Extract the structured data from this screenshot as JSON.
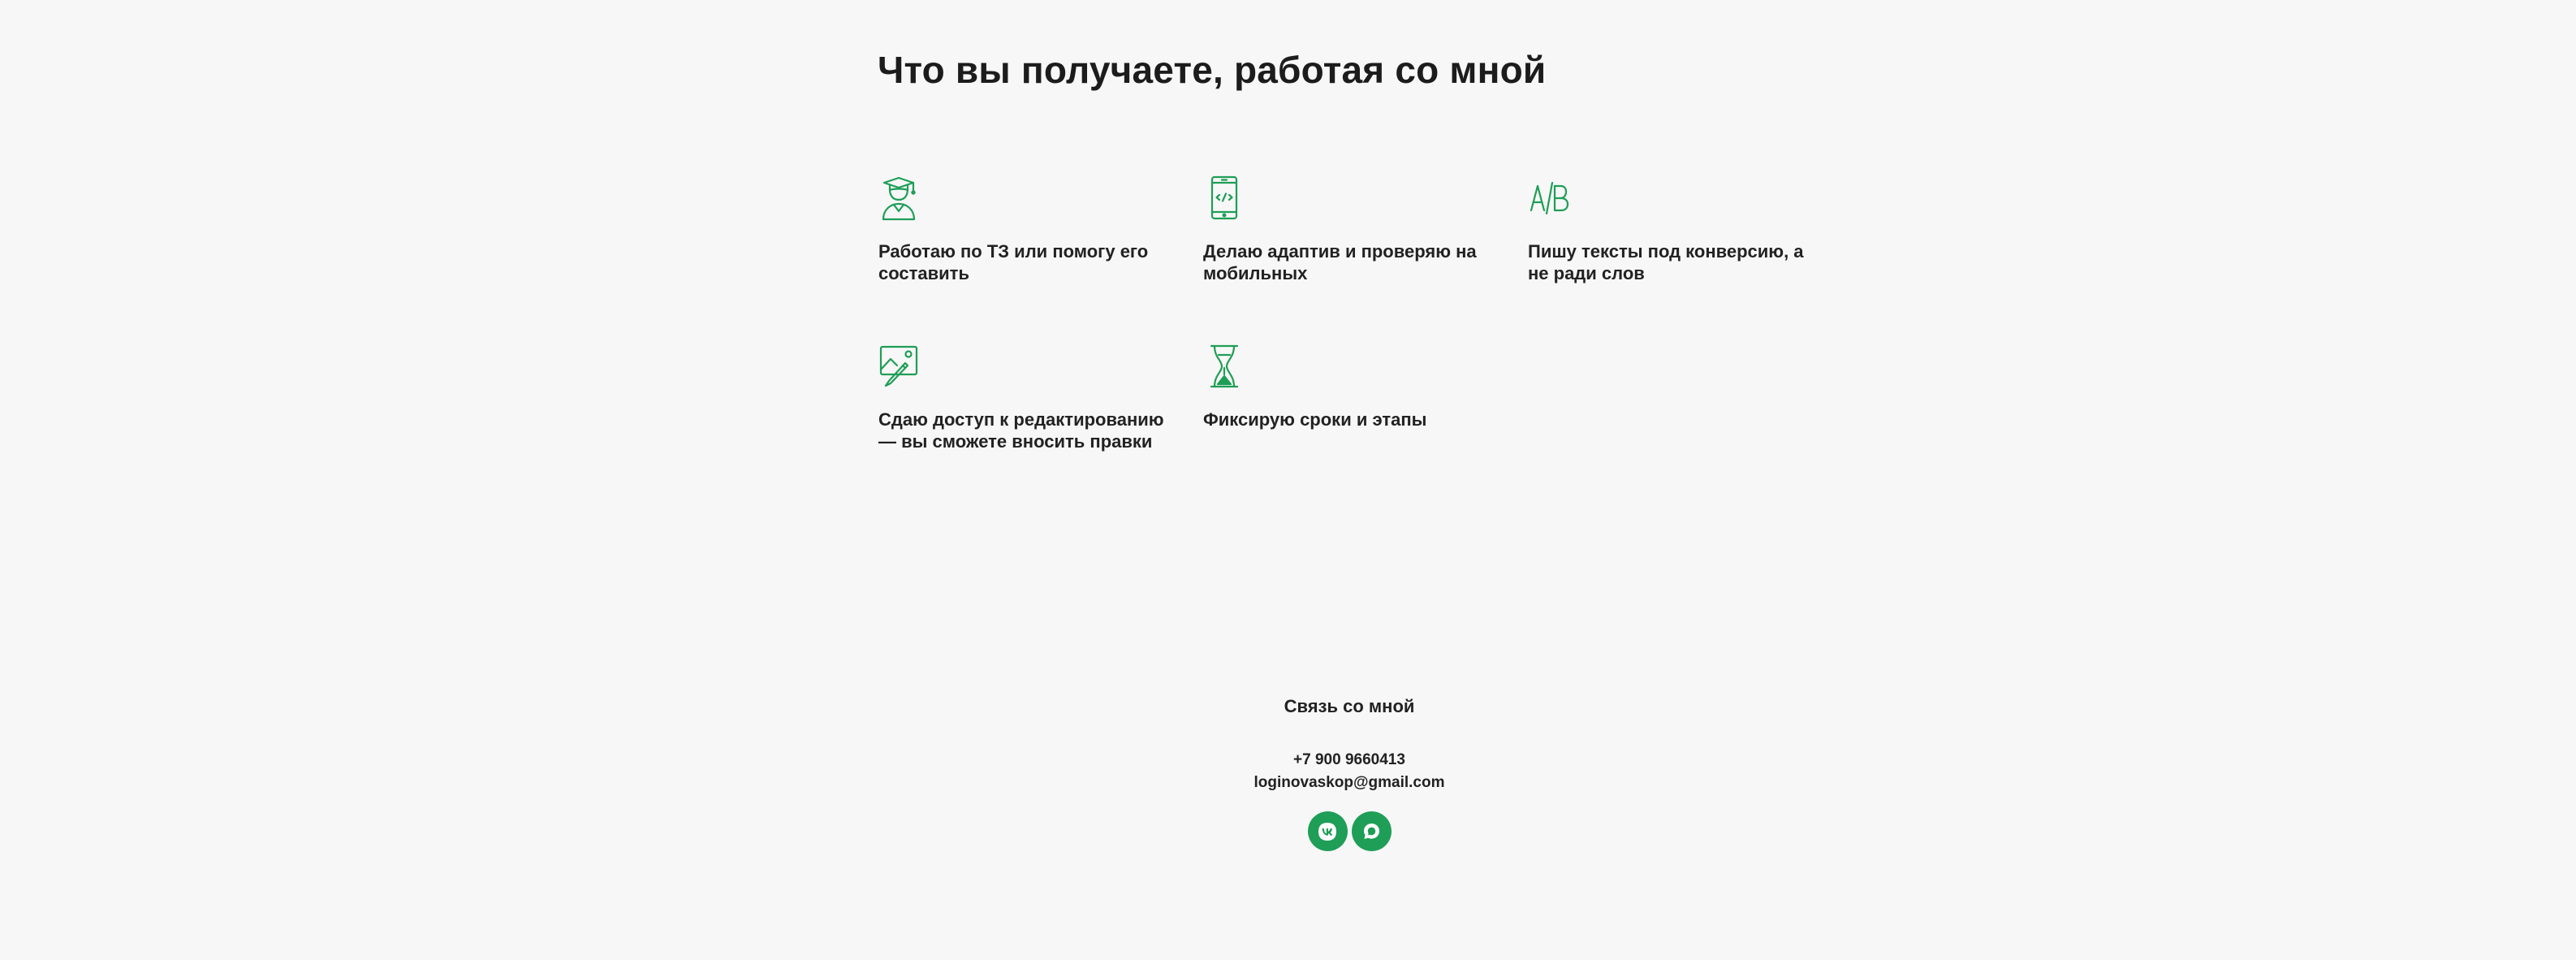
{
  "section": {
    "title": "Что вы получаете, работая со мной"
  },
  "features": [
    {
      "icon": "graduate-icon",
      "text": "Работаю по ТЗ или помогу его составить"
    },
    {
      "icon": "mobile-code-icon",
      "text": "Делаю адаптив и проверяю на мобильных"
    },
    {
      "icon": "ab-test-icon",
      "text": "Пишу тексты под конверсию, а не ради слов"
    },
    {
      "icon": "image-edit-icon",
      "text": "Сдаю доступ к редактированию — вы сможете вносить правки"
    },
    {
      "icon": "hourglass-icon",
      "text": "Фиксирую сроки и этапы"
    }
  ],
  "contacts": {
    "title": "Связь со мной",
    "phone": "+7 900 9660413",
    "email": "loginovaskop@gmail.com",
    "socials": [
      {
        "icon": "vk-icon"
      },
      {
        "icon": "chat-icon"
      }
    ]
  },
  "colors": {
    "accent": "#1e9e56",
    "background": "#f7f7f7",
    "text": "#1f1f1f"
  }
}
